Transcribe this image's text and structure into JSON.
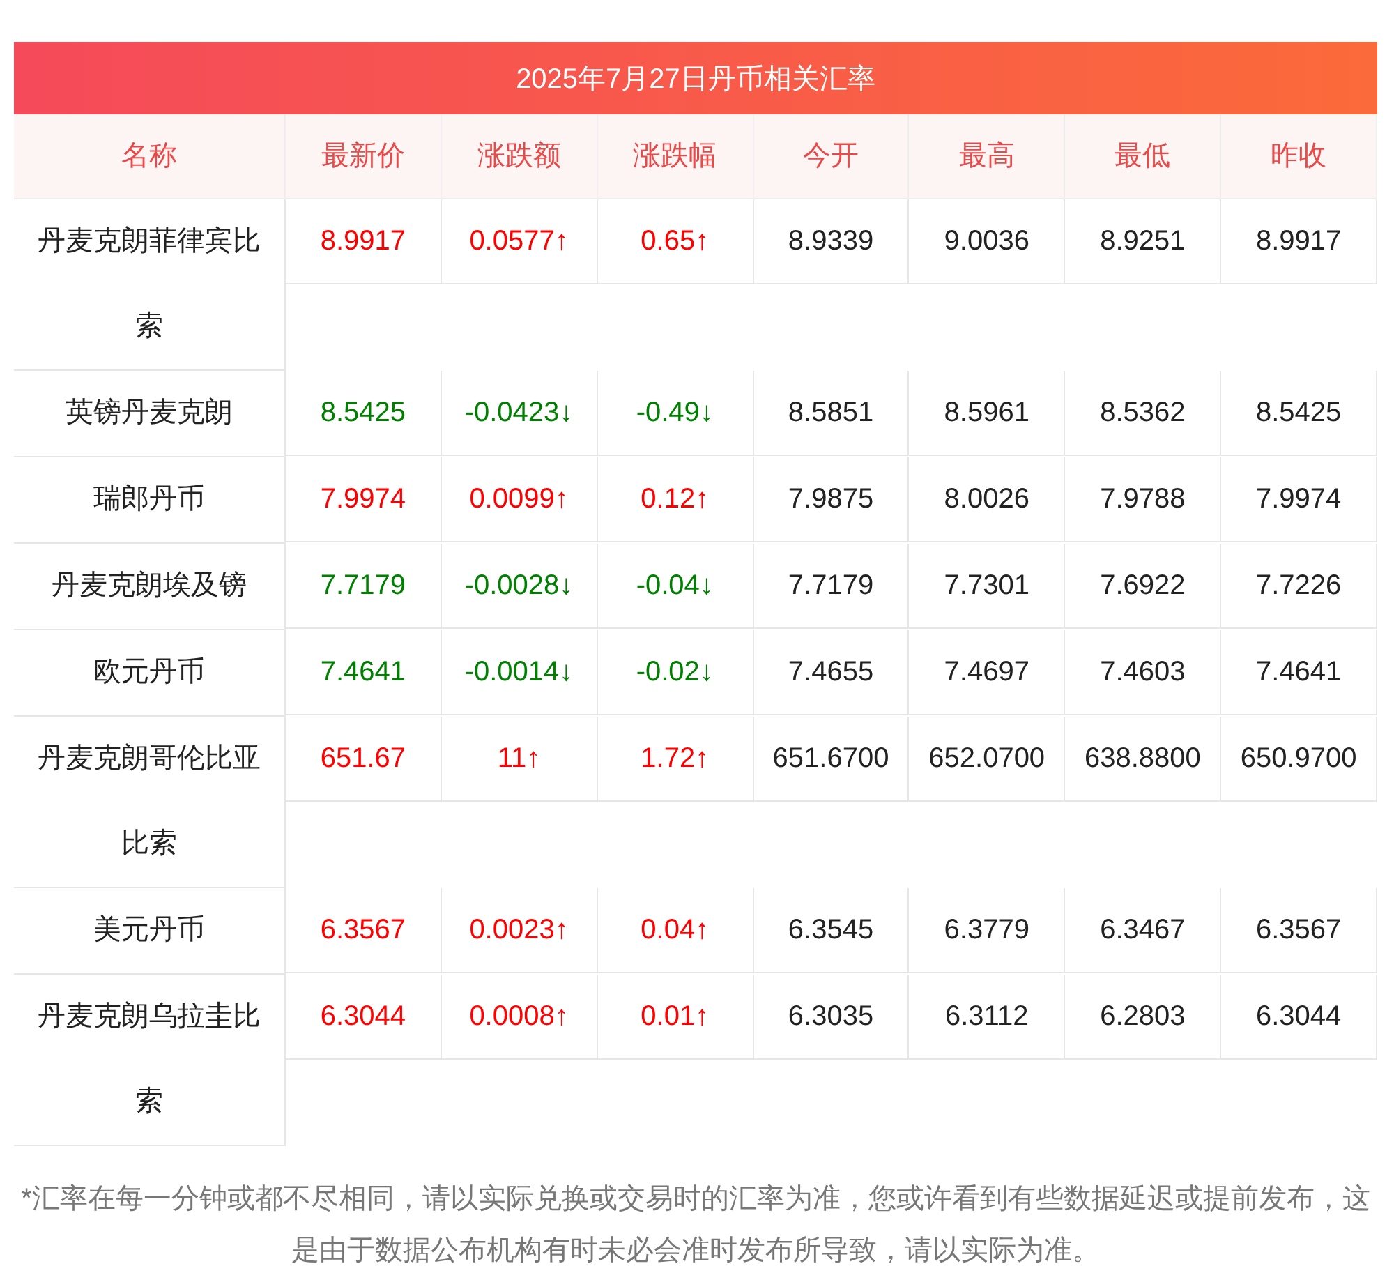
{
  "title": "2025年7月27日丹币相关汇率",
  "columns": [
    "名称",
    "最新价",
    "涨跌额",
    "涨跌幅",
    "今开",
    "最高",
    "最低",
    "昨收"
  ],
  "rows": [
    {
      "name": "丹麦克朗菲律宾比索",
      "rising": true,
      "values": [
        "8.9917",
        "0.0577↑",
        "0.65↑",
        "8.9339",
        "9.0036",
        "8.9251",
        "8.9917"
      ]
    },
    {
      "name": "英镑丹麦克朗",
      "rising": false,
      "values": [
        "8.5425",
        "-0.0423↓",
        "-0.49↓",
        "8.5851",
        "8.5961",
        "8.5362",
        "8.5425"
      ]
    },
    {
      "name": "瑞郎丹币",
      "rising": true,
      "values": [
        "7.9974",
        "0.0099↑",
        "0.12↑",
        "7.9875",
        "8.0026",
        "7.9788",
        "7.9974"
      ]
    },
    {
      "name": "丹麦克朗埃及镑",
      "rising": false,
      "values": [
        "7.7179",
        "-0.0028↓",
        "-0.04↓",
        "7.7179",
        "7.7301",
        "7.6922",
        "7.7226"
      ]
    },
    {
      "name": "欧元丹币",
      "rising": false,
      "values": [
        "7.4641",
        "-0.0014↓",
        "-0.02↓",
        "7.4655",
        "7.4697",
        "7.4603",
        "7.4641"
      ]
    },
    {
      "name": "丹麦克朗哥伦比亚比索",
      "rising": true,
      "values": [
        "651.67",
        "11↑",
        "1.72↑",
        "651.6700",
        "652.0700",
        "638.8800",
        "650.9700"
      ]
    },
    {
      "name": "美元丹币",
      "rising": true,
      "values": [
        "6.3567",
        "0.0023↑",
        "0.04↑",
        "6.3545",
        "6.3779",
        "6.3467",
        "6.3567"
      ]
    },
    {
      "name": "丹麦克朗乌拉圭比索",
      "rising": true,
      "values": [
        "6.3044",
        "0.0008↑",
        "0.01↑",
        "6.3035",
        "6.3112",
        "6.2803",
        "6.3044"
      ]
    }
  ],
  "note": "*汇率在每一分钟或都不尽相同，请以实际兑换或交易时的汇率为准，您或许看到有些数据延迟或提前发布，这是由于数据公布机构有时未必会准时发布所导致，请以实际为准。"
}
